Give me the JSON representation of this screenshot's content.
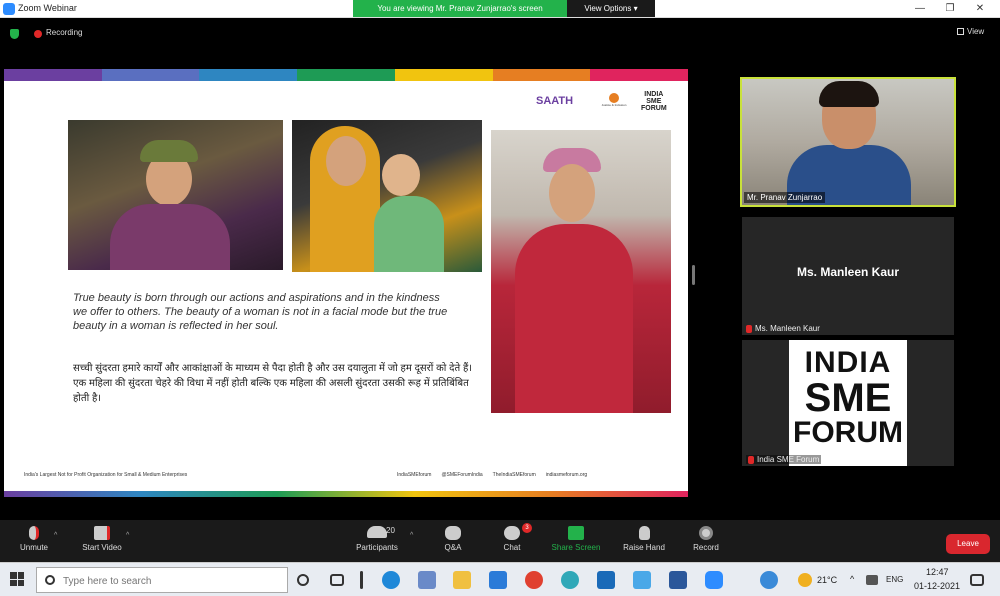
{
  "window": {
    "title": "Zoom Webinar",
    "minimize": "—",
    "maximize": "❐",
    "close": "✕"
  },
  "share_banner": "You are viewing Mr. Pranav Zunjarrao's screen",
  "view_options": "View Options ▾",
  "status": {
    "recording": "Recording",
    "view": "View"
  },
  "slide": {
    "logo_saath": "SAATH",
    "logo_mid_text": "Justice & Inclusion",
    "logo_india_sme": [
      "INDIA",
      "SME",
      "FORUM"
    ],
    "topbar_colors": [
      "#6b3fa0",
      "#5a6fc0",
      "#2e86c1",
      "#1e9b55",
      "#f1c40f",
      "#e67e22",
      "#e0245e"
    ],
    "quote_en": "True beauty is born through our actions and aspirations and in the kindness we offer to others. The beauty of a woman is not in a facial mode but the true beauty in a woman is reflected in her soul.",
    "quote_hi": "सच्ची सुंदरता हमारे कार्यों और आकांक्षाओं के माध्यम से पैदा होती है और उस दयालुता में जो हम दूसरों को देते हैं। एक महिला की सुंदरता चेहरे की विधा में नहीं होती बल्कि एक महिला की असली सुंदरता उसकी रूह में प्रतिबिंबित होती है।",
    "footer_left": "India's Largest Not for Profit Organization for Small & Medium Enterprises",
    "footer_links": [
      "IndiaSMEforum",
      "@SMEForumIndia",
      "TheIndiaSMEforum",
      "indiasmeforum.org"
    ]
  },
  "participants": [
    {
      "name": "Mr. Pranav Zunjarrao"
    },
    {
      "name": "Ms. Manleen Kaur"
    },
    {
      "name": "India SME Forum"
    }
  ],
  "sme_logo": [
    "INDIA",
    "SME",
    "FORUM"
  ],
  "toolbar": {
    "unmute": "Unmute",
    "start_video": "Start Video",
    "participants": "Participants",
    "participants_count": "20",
    "qa": "Q&A",
    "chat": "Chat",
    "chat_badge": "3",
    "share_screen": "Share Screen",
    "raise_hand": "Raise Hand",
    "record": "Record",
    "leave": "Leave"
  },
  "taskbar": {
    "search_placeholder": "Type here to search",
    "temperature": "21°C",
    "lang": "ENG",
    "time": "12:47",
    "date": "01-12-2021"
  }
}
